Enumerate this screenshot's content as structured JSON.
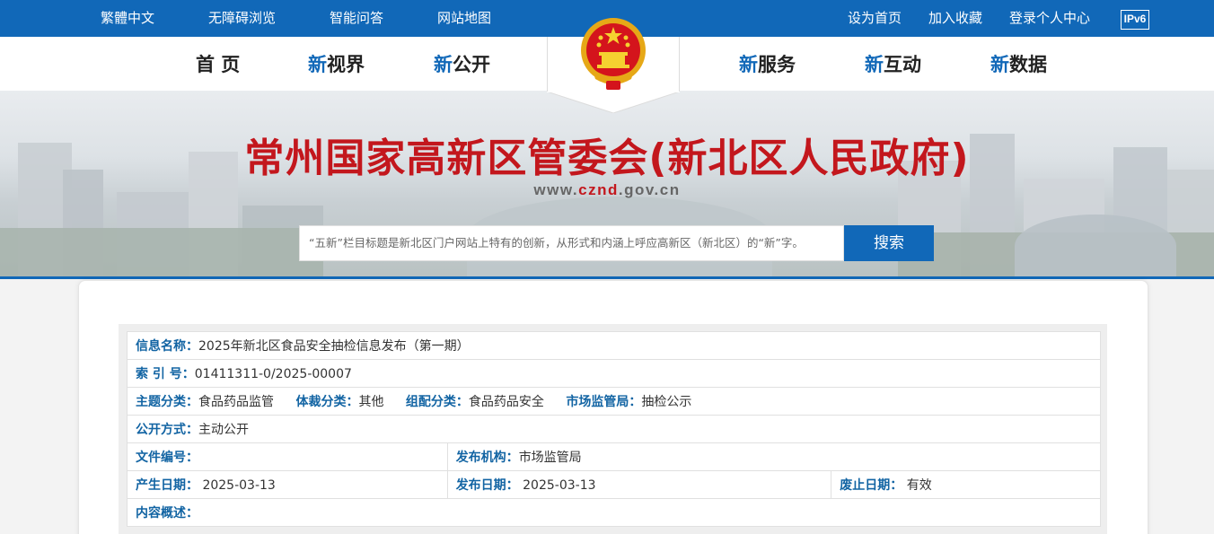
{
  "topbar": {
    "left_links": [
      "繁體中文",
      "无障碍浏览",
      "智能问答",
      "网站地图"
    ],
    "right_links": [
      "设为首页",
      "加入收藏",
      "登录个人中心"
    ],
    "ipv6": "IPv6"
  },
  "nav": {
    "home": "首 页",
    "items": [
      {
        "prefix": "新",
        "label": "视界"
      },
      {
        "prefix": "新",
        "label": "公开"
      },
      {
        "prefix": "新",
        "label": "服务"
      },
      {
        "prefix": "新",
        "label": "互动"
      },
      {
        "prefix": "新",
        "label": "数据"
      }
    ]
  },
  "banner": {
    "title": "常州国家高新区管委会(新北区人民政府)",
    "url_prefix": "www.",
    "url_red": "cznd",
    "url_suffix": ".gov.cn"
  },
  "search": {
    "placeholder": "“五新”栏目标题是新北区门户网站上特有的创新，从形式和内涵上呼应高新区（新北区）的“新”字。",
    "button": "搜索"
  },
  "info": {
    "name_label": "信息名称：",
    "name_value": "2025年新北区食品安全抽检信息发布（第一期）",
    "index_label": "索 引 号：",
    "index_value": "01411311-0/2025-00007",
    "topic_label": "主题分类：",
    "topic_value": "食品药品监管",
    "genre_label": "体裁分类：",
    "genre_value": "其他",
    "org_cat_label": "组配分类：",
    "org_cat_value": "食品药品安全",
    "bureau_label": "市场监管局：",
    "bureau_value": "抽检公示",
    "method_label": "公开方式：",
    "method_value": "主动公开",
    "docno_label": "文件编号：",
    "docno_value": "",
    "publisher_label": "发布机构：",
    "publisher_value": "市场监管局",
    "created_label": "产生日期：",
    "created_value": "2025-03-13",
    "published_label": "发布日期：",
    "published_value": "2025-03-13",
    "expire_label": "废止日期：",
    "expire_value": "有效",
    "summary_label": "内容概述：",
    "summary_value": ""
  },
  "colors": {
    "primary_blue": "#1168b8",
    "title_red": "#c3171d",
    "label_blue": "#1264a3"
  }
}
